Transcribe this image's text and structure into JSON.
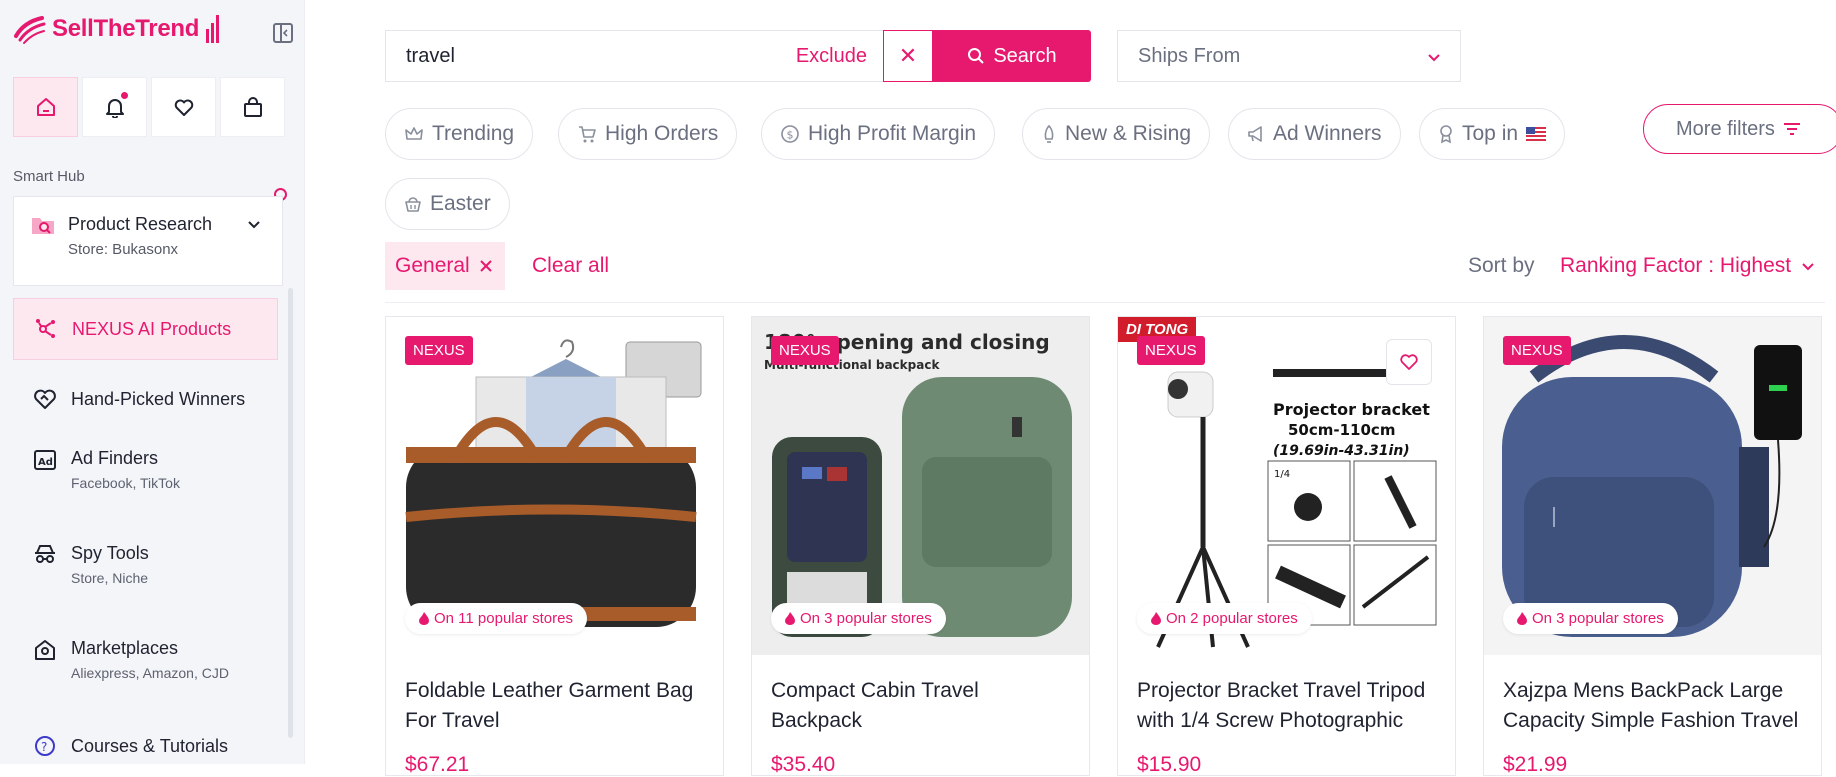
{
  "brand": {
    "name": "SellTheTrend",
    "accent": "#e6196f"
  },
  "sidebar": {
    "top_icons": [
      {
        "name": "home-icon"
      },
      {
        "name": "bell-icon"
      },
      {
        "name": "heart-icon"
      },
      {
        "name": "shopping-bag-icon"
      }
    ],
    "section_label": "Smart Hub",
    "product_research": {
      "title": "Product Research",
      "store": "Store: Bukasonx"
    },
    "items": [
      {
        "label": "NEXUS AI Products",
        "sub": ""
      },
      {
        "label": "Hand-Picked Winners",
        "sub": ""
      },
      {
        "label": "Ad Finders",
        "sub": "Facebook, TikTok"
      },
      {
        "label": "Spy Tools",
        "sub": "Store, Niche"
      },
      {
        "label": "Marketplaces",
        "sub": "Aliexpress, Amazon, CJD"
      },
      {
        "label": "Courses & Tutorials",
        "sub": ""
      }
    ]
  },
  "search": {
    "value": "travel",
    "exclude_label": "Exclude",
    "clear_label": "✕",
    "button_label": "Search"
  },
  "ships_from": {
    "placeholder": "Ships From"
  },
  "filters": {
    "chips": [
      "Trending",
      "High Orders",
      "High Profit Margin",
      "New & Rising",
      "Ad Winners",
      "Top in",
      "Easter"
    ],
    "more_label": "More filters"
  },
  "active_tags": {
    "general": "General",
    "clear_all": "Clear all"
  },
  "sort": {
    "label": "Sort by",
    "value": "Ranking Factor : Highest"
  },
  "products": [
    {
      "badge": "NEXUS",
      "popular": "On 11 popular stores",
      "title": "Foldable Leather Garment Bag For Travel",
      "price": "$67.21"
    },
    {
      "badge": "NEXUS",
      "popular": "On 3 popular stores",
      "title": "Compact Cabin Travel Backpack",
      "price": "$35.40",
      "image_text": "180° opening and closing",
      "image_subtext": "Multi-functional backpack"
    },
    {
      "badge": "NEXUS",
      "popular": "On 2 popular stores",
      "title": "Projector Bracket Travel Tripod with 1/4 Screw Photographic",
      "price": "$15.90",
      "brand_tag": "DI TONG",
      "image_text": "Projector bracket",
      "image_subtext": "50cm-110cm",
      "image_subtext2": "(19.69in-43.31in)",
      "detail_label": "1/4"
    },
    {
      "badge": "NEXUS",
      "popular": "On 3 popular stores",
      "title": "Xajzpa Mens BackPack Large Capacity Simple Fashion Travel",
      "price": "$21.99"
    }
  ]
}
